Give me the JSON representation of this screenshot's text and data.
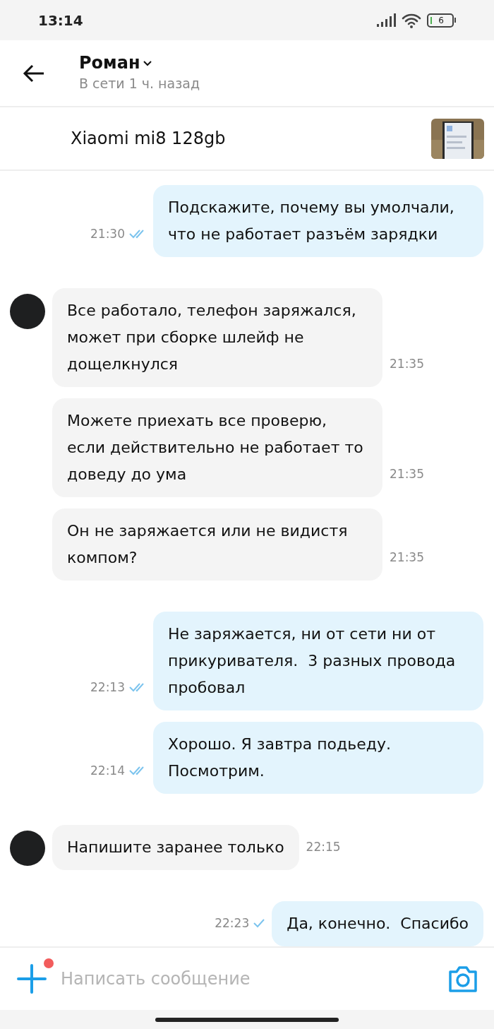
{
  "status_bar": {
    "time": "13:14",
    "battery": "6"
  },
  "header": {
    "name": "Роман",
    "last_seen": "В сети 1 ч. назад"
  },
  "listing": {
    "title": "Xiaomi mi8 128gb"
  },
  "messages": [
    {
      "outgoing": true,
      "read": true,
      "text": "Подскажите, почему вы умолчали, что не работает разъём зарядки",
      "time": "21:30"
    },
    {
      "outgoing": false,
      "avatar": true,
      "text": "Все работало, телефон заряжался, может при сборке шлейф не дощелкнулся",
      "time": "21:35"
    },
    {
      "outgoing": false,
      "avatar": false,
      "text": "Можете приехать все проверю, если действительно не работает то доведу до ума",
      "time": "21:35"
    },
    {
      "outgoing": false,
      "avatar": false,
      "text": "Он не заряжается или не видистя компом?",
      "time": "21:35"
    },
    {
      "outgoing": true,
      "read": true,
      "text": "Не заряжается, ни от сети ни от прикуривателя.  3 разных провода пробовал",
      "time": "22:13"
    },
    {
      "outgoing": true,
      "read": true,
      "text": "Хорошо. Я завтра подьеду. Посмотрим.",
      "time": "22:14"
    },
    {
      "outgoing": false,
      "avatar": true,
      "text": "Напишите заранее только",
      "time": "22:15"
    },
    {
      "outgoing": true,
      "read": false,
      "text": "Да, конечно.  Спасибо",
      "time": "22:23"
    }
  ],
  "composer": {
    "placeholder": "Написать сообщение",
    "attach_badge": true
  }
}
